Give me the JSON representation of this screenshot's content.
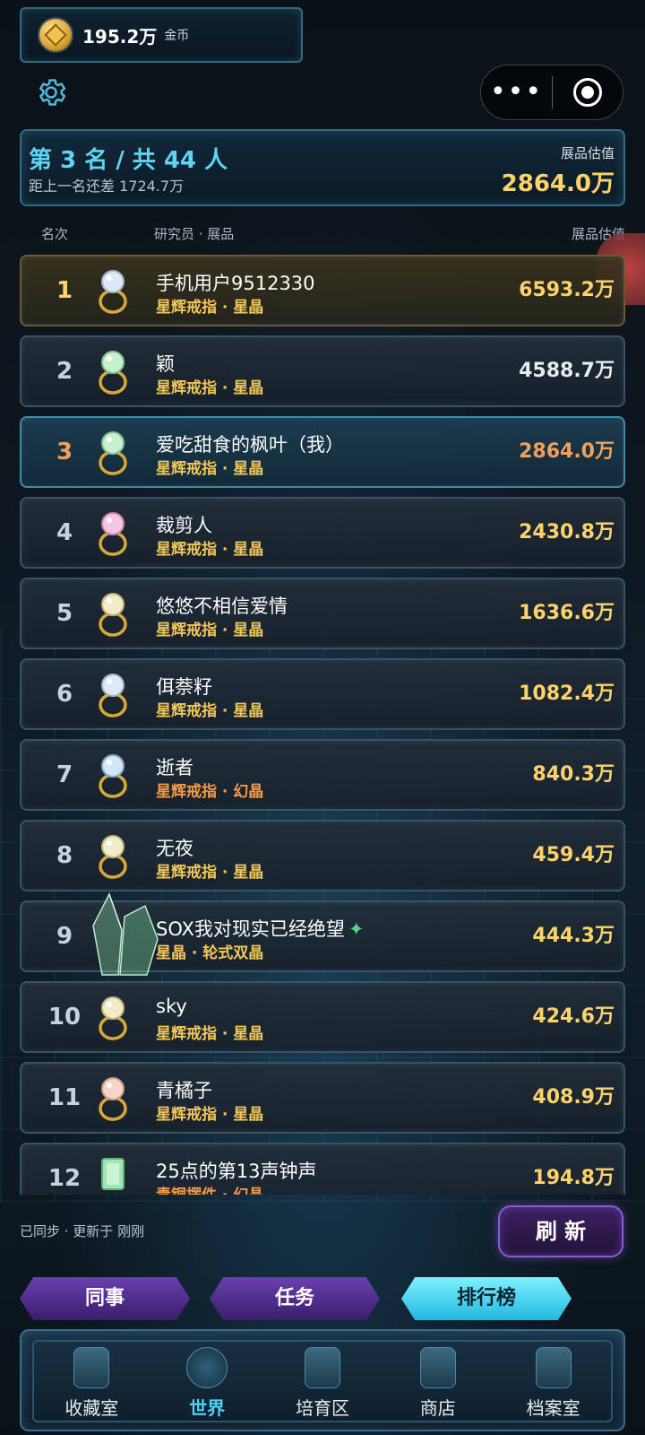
{
  "header": {
    "coin_amount": "195.2万",
    "coin_unit": "金币",
    "menu_dots": "•••"
  },
  "my_rank": {
    "rank_text": "第 3 名 / 共 44 人",
    "gap_text": "距上一名还差 1724.7万",
    "value_label": "展品估值",
    "value": "2864.0万"
  },
  "table_header": {
    "rank": "名次",
    "researcher": "研究员 · 展品",
    "value": "展品估值"
  },
  "rows": [
    {
      "rank": "1",
      "name": "手机用户9512330",
      "sub": "星辉戒指 · 星晶",
      "value": "6593.2万"
    },
    {
      "rank": "2",
      "name": "颖",
      "sub": "星辉戒指 · 星晶",
      "value": "4588.7万"
    },
    {
      "rank": "3",
      "name": "爱吃甜食的枫叶（我）",
      "sub": "星辉戒指 · 星晶",
      "value": "2864.0万"
    },
    {
      "rank": "4",
      "name": "裁剪人",
      "sub": "星辉戒指 · 星晶",
      "value": "2430.8万"
    },
    {
      "rank": "5",
      "name": "悠悠不相信爱情",
      "sub": "星辉戒指 · 星晶",
      "value": "1636.6万"
    },
    {
      "rank": "6",
      "name": "佴萘籽",
      "sub": "星辉戒指 · 星晶",
      "value": "1082.4万"
    },
    {
      "rank": "7",
      "name": "逝者",
      "sub": "星辉戒指 · 幻晶",
      "value": "840.3万"
    },
    {
      "rank": "8",
      "name": "无夜",
      "sub": "星辉戒指 · 星晶",
      "value": "459.4万"
    },
    {
      "rank": "9",
      "name": "SOX我对现实已经绝望",
      "sub": "星晶 · 轮式双晶",
      "value": "444.3万"
    },
    {
      "rank": "10",
      "name": "sky",
      "sub": "星辉戒指 · 星晶",
      "value": "424.6万"
    },
    {
      "rank": "11",
      "name": "青橘子",
      "sub": "星辉戒指 · 星晶",
      "value": "408.9万"
    },
    {
      "rank": "12",
      "name": "25点的第13声钟声",
      "sub": "青铜摆件 · 幻晶",
      "value": "194.8万"
    }
  ],
  "status": {
    "sync_text": "已同步 · 更新于 刚刚",
    "refresh_label": "刷 新"
  },
  "tabs": [
    {
      "label": "同事"
    },
    {
      "label": "任务"
    },
    {
      "label": "排行榜"
    }
  ],
  "nav": [
    {
      "label": "收藏室"
    },
    {
      "label": "世界"
    },
    {
      "label": "培育区"
    },
    {
      "label": "商店"
    },
    {
      "label": "档案室"
    }
  ],
  "colors": {
    "accent_cyan": "#5fd3f0",
    "gold": "#ffd36b",
    "orange": "#f0a05a",
    "purple": "#8a5ad8"
  }
}
